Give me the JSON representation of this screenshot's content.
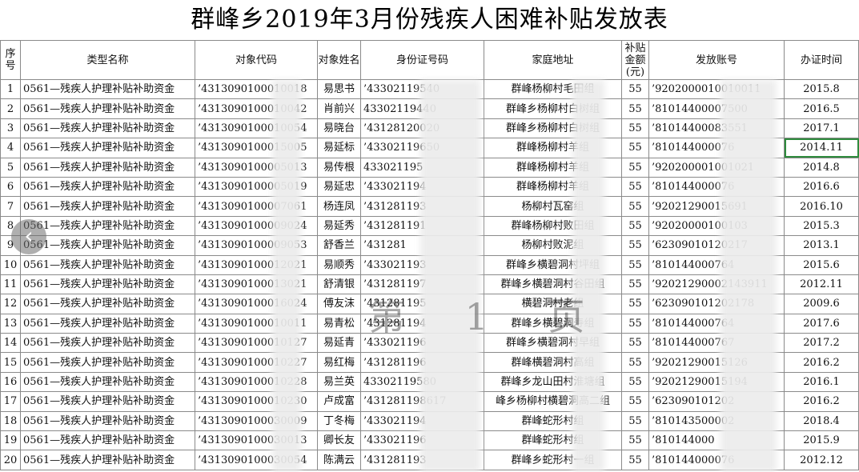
{
  "title": "群峰乡2019年3月份残疾人困难补贴发放表",
  "watermark": "第 1 页",
  "nav_icon": "chevron-left-icon",
  "selection_color": "#2e8b3d",
  "headers": [
    "序号",
    "类型名称",
    "对象代码",
    "对象姓名",
    "身份证号码",
    "家庭地址",
    "补贴金额(元)",
    "发放账号",
    "办证时间"
  ],
  "rows": [
    [
      "1",
      "0561—残疾人护理补贴补助资金",
      "’4313090100010018",
      "易思书",
      "’43302119540",
      "群峰杨柳村毛田组",
      "55",
      "’9202000010010011",
      "2015.8"
    ],
    [
      "2",
      "0561—残疾人护理补贴补助资金",
      "’4313090100010042",
      "肖前兴",
      "43302119440",
      "群峰乡杨柳村白树组",
      "55",
      "’81014400007500",
      "2016.5"
    ],
    [
      "3",
      "0561—残疾人护理补贴补助资金",
      "’4313090100010054",
      "易晓台",
      "’43128120020",
      "群峰乡杨柳村白树组",
      "55",
      "’81014400083551",
      "2017.1"
    ],
    [
      "4",
      "0561—残疾人护理补贴补助资金",
      "’4313090100015005",
      "易延标",
      "’43302119650",
      "群峰杨柳村羊组",
      "55",
      "’810144000076",
      "2014.11"
    ],
    [
      "5",
      "0561—残疾人护理补贴补助资金",
      "’4313090100005013",
      "易传根",
      "433021195",
      "群峰杨柳村羊组",
      "55",
      "’920200001001021",
      "2014.8"
    ],
    [
      "6",
      "0561—残疾人护理补贴补助资金",
      "’4313090100005019",
      "易延忠",
      "’433021194",
      "群峰杨柳村羊组",
      "55",
      "’810144000076",
      "2016.6"
    ],
    [
      "7",
      "0561—残疾人护理补贴补助资金",
      "’4313090100007061",
      "杨连凤",
      "’431281193",
      "杨柳村瓦窑组",
      "55",
      "’92021290015691",
      "2016.10"
    ],
    [
      "8",
      "0561—残疾人护理补贴补助资金",
      "’4313090100009024",
      "易延秀",
      "’431281191",
      "群峰杨柳村败田组",
      "55",
      "’92020000100103",
      "2015.3"
    ],
    [
      "9",
      "0561—残疾人护理补贴补助资金",
      "’4313090100009053",
      "舒香兰",
      "’431281",
      "杨柳村败泥组",
      "55",
      "’62309010120217",
      "2013.1"
    ],
    [
      "10",
      "0561—残疾人护理补贴补助资金",
      "’4313090100012021",
      "易顺秀",
      "’433021193",
      "群峰乡横碧洞村坪组",
      "55",
      "’810144000764",
      "2015.6"
    ],
    [
      "11",
      "0561—残疾人护理补贴补助资金",
      "’4313090100013021",
      "舒清银",
      "’431281197",
      "群峰乡横碧洞村谷田组",
      "55",
      "’92021290002143911",
      "2012.11"
    ],
    [
      "12",
      "0561—残疾人护理补贴补助资金",
      "’4313090100016024",
      "傅友沫",
      "’431281195",
      "横碧洞村老组",
      "55",
      "’623090101202178",
      "2009.6"
    ],
    [
      "13",
      "0561—残疾人护理补贴补助资金",
      "’4313090100010011",
      "易青松",
      "’431281194",
      "群峰乡横碧洞寿组",
      "55",
      "’810144000764",
      "2017.6"
    ],
    [
      "14",
      "0561—残疾人护理补贴补助资金",
      "’4313090100010127",
      "易延青",
      "’433021196",
      "群峰乡横碧洞村早组",
      "55",
      "’810144000767",
      "2017.2"
    ],
    [
      "15",
      "0561—残疾人护理补贴补助资金",
      "’4313090100010227",
      "易红梅",
      "’431281196",
      "群峰横碧洞村高组",
      "55",
      "’92021290015126",
      "2016.2"
    ],
    [
      "16",
      "0561—残疾人护理补贴补助资金",
      "’4313090100010228",
      "易兰英",
      "43302119580",
      "群峰乡龙山田村淮塘组",
      "55",
      "’92021290015194",
      "2016.1"
    ],
    [
      "17",
      "0561—残疾人护理补贴补助资金",
      "’4313090100010230",
      "卢成富",
      "’431281198617",
      "峰乡杨柳村横碧洞高二组",
      "55",
      "’623090101202",
      "2016.2"
    ],
    [
      "18",
      "0561—残疾人护理补贴补助资金",
      "’4313090100030009",
      "丁冬梅",
      "’433021194",
      "群峰蛇形村组",
      "55",
      "’810143500002",
      "2018.4"
    ],
    [
      "19",
      "0561—残疾人护理补贴补助资金",
      "’4313090100030013",
      "卿长友",
      "’433021196",
      "群峰蛇形村组",
      "55",
      "’810144000",
      "2015.9"
    ],
    [
      "20",
      "0561—残疾人护理补贴补助资金",
      "’4313090100030054",
      "陈满云",
      "’431281193",
      "群峰乡蛇形村一组",
      "55",
      "’810144000076",
      "2012.12"
    ]
  ]
}
